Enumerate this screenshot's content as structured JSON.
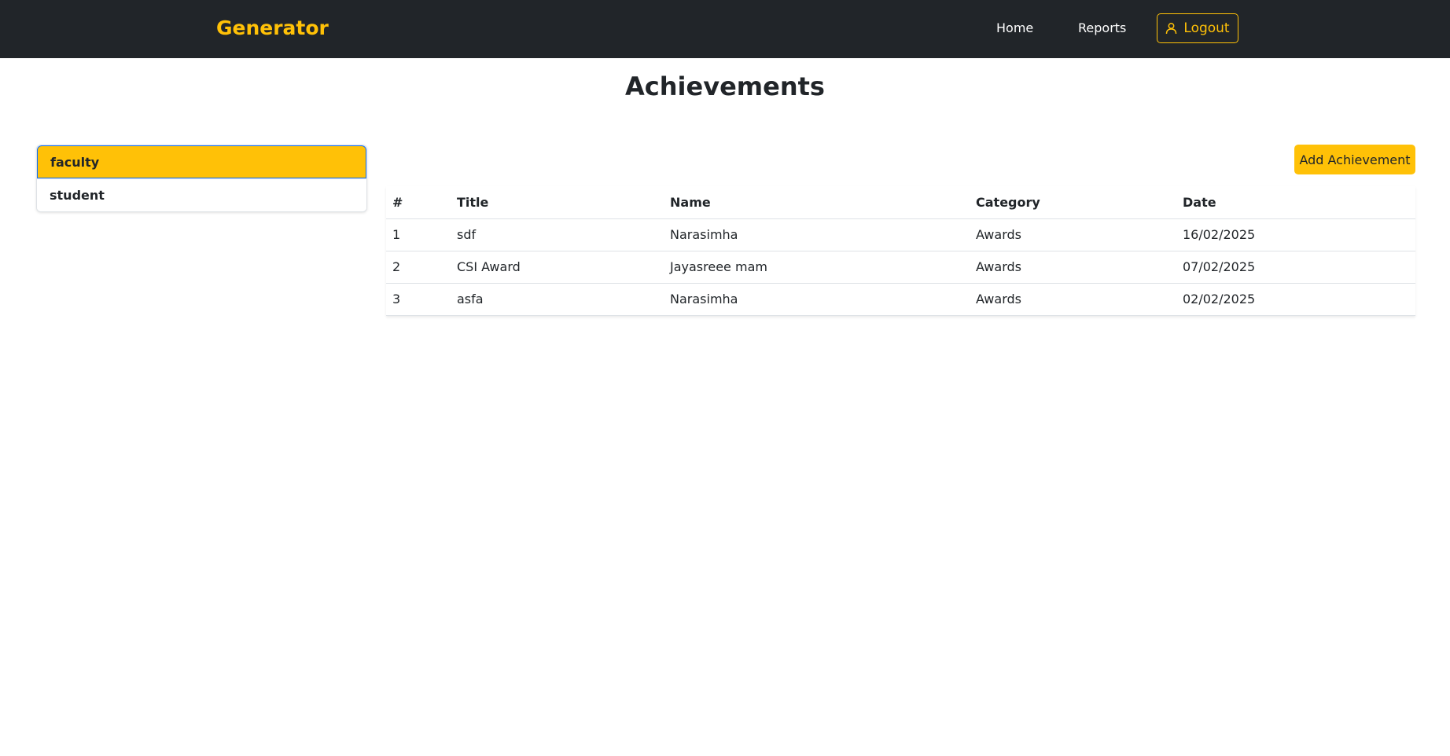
{
  "navbar": {
    "brand": "Generator",
    "links": [
      {
        "label": "Home"
      },
      {
        "label": "Reports"
      }
    ],
    "logout_label": "Logout",
    "logout_icon": "user-icon",
    "background": "#212529",
    "accent": "#ffc107"
  },
  "page": {
    "title": "Achievements"
  },
  "sidebar": {
    "items": [
      {
        "label": "faculty",
        "active": true
      },
      {
        "label": "student",
        "active": false
      }
    ]
  },
  "actions": {
    "add_label": "Add Achievement"
  },
  "table": {
    "headers": [
      "#",
      "Title",
      "Name",
      "Category",
      "Date"
    ],
    "rows": [
      {
        "num": "1",
        "title": "sdf",
        "name": "Narasimha",
        "category": "Awards",
        "date": "16/02/2025"
      },
      {
        "num": "2",
        "title": "CSI Award",
        "name": "Jayasreee mam",
        "category": "Awards",
        "date": "07/02/2025"
      },
      {
        "num": "3",
        "title": "asfa",
        "name": "Narasimha",
        "category": "Awards",
        "date": "02/02/2025"
      }
    ]
  }
}
